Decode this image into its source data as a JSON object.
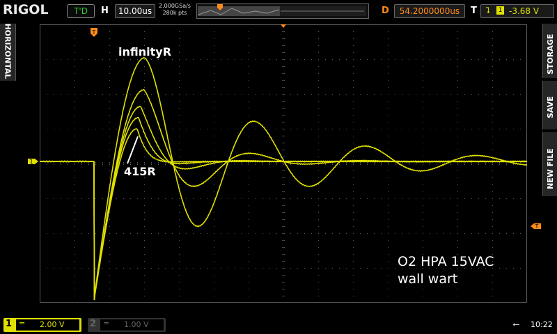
{
  "header": {
    "brand": "RIGOL",
    "run_state": "T'D",
    "timebase_label": "H",
    "timebase_value": "10.00us",
    "sample_rate": "2.000GSa/s",
    "memory_depth": "280k pts",
    "delay_label": "D",
    "delay_value": "54.2000000us",
    "trigger_label": "T",
    "trigger_source": "1",
    "trigger_level": "-3.68 V"
  },
  "side_menu": {
    "left_tab": "HORIZONTAL",
    "storage": "STORAGE",
    "save": "SAVE",
    "new_file": "NEW FILE"
  },
  "channels": [
    {
      "number": "1",
      "coupling": "=",
      "scale": "2.00 V",
      "active": true
    },
    {
      "number": "2",
      "coupling": "=",
      "scale": "1.00 V",
      "active": false
    }
  ],
  "status": {
    "time": "10:22",
    "usb_icon": "usb-icon"
  },
  "markers": {
    "channel1_ground": "1",
    "trigger_level_marker": "T"
  },
  "annotations": {
    "top_trace_label": "infinityR",
    "bottom_trace_label": "415R",
    "note_line1": "O2 HPA 15VAC",
    "note_line2": "wall wart"
  },
  "colors": {
    "trace": "#e0e000",
    "grid": "#5a5a5a",
    "accent_orange": "#ff8c1a",
    "run_green": "#33cc33"
  }
}
